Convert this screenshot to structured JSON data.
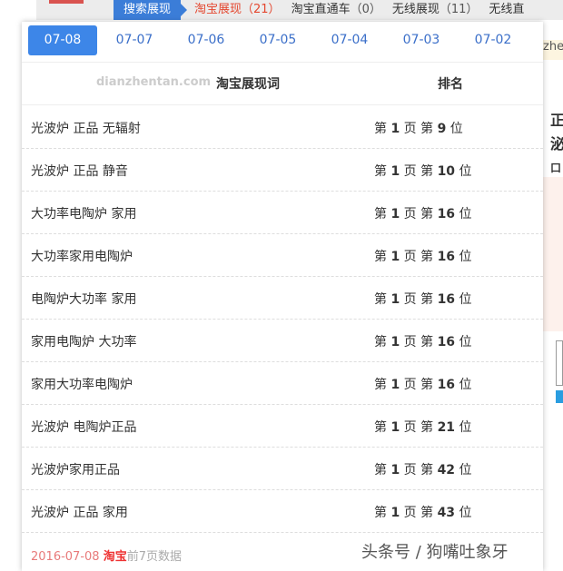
{
  "breadcrumb": {
    "active": "搜索展现",
    "items": [
      {
        "label": "淘宝展现",
        "count": "（21）"
      },
      {
        "label": "淘宝直通车",
        "count": "（0）"
      },
      {
        "label": "无线展现",
        "count": "（11）"
      },
      {
        "label": "无线直",
        "count": ""
      }
    ]
  },
  "side_text": {
    "zhe": "zhe",
    "c1": "正",
    "c2": "泌",
    "c3": "口"
  },
  "tabs": [
    "07-08",
    "07-07",
    "07-06",
    "07-05",
    "07-04",
    "07-03",
    "07-02"
  ],
  "active_tab": 0,
  "table": {
    "watermark": "dianzhentan.com",
    "headers": [
      "淘宝展现词",
      "排名"
    ],
    "rows": [
      {
        "keyword": "光波炉 正品 无辐射",
        "page": "1",
        "pos": "9"
      },
      {
        "keyword": "光波炉 正品 静音",
        "page": "1",
        "pos": "10"
      },
      {
        "keyword": "大功率电陶炉 家用",
        "page": "1",
        "pos": "16"
      },
      {
        "keyword": "大功率家用电陶炉",
        "page": "1",
        "pos": "16"
      },
      {
        "keyword": "电陶炉大功率 家用",
        "page": "1",
        "pos": "16"
      },
      {
        "keyword": "家用电陶炉 大功率",
        "page": "1",
        "pos": "16"
      },
      {
        "keyword": "家用大功率电陶炉",
        "page": "1",
        "pos": "16"
      },
      {
        "keyword": "光波炉 电陶炉正品",
        "page": "1",
        "pos": "21"
      },
      {
        "keyword": "光波炉家用正品",
        "page": "1",
        "pos": "42"
      },
      {
        "keyword": "光波炉 正品 家用",
        "page": "1",
        "pos": "43"
      }
    ],
    "rank_words": {
      "di": "第",
      "ye": "页",
      "wei": "位"
    }
  },
  "footer": {
    "date": "2016-07-08",
    "platform": "淘宝",
    "desc": "前7页数据"
  },
  "credit": "头条号 / 狗嘴吐象牙"
}
